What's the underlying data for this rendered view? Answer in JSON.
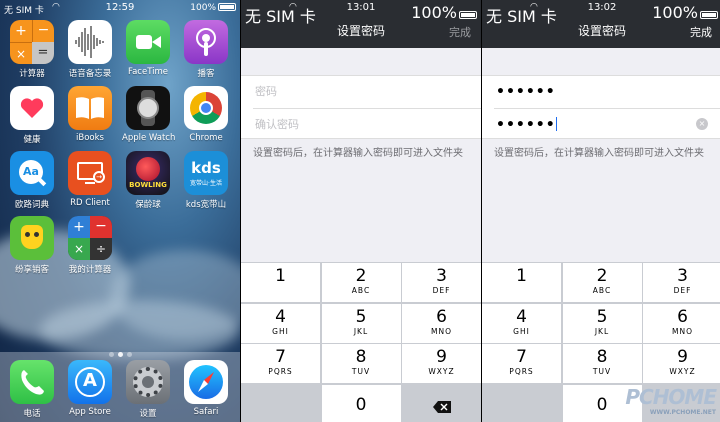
{
  "home": {
    "status": {
      "carrier": "无 SIM 卡",
      "time": "12:59",
      "battery": "100%"
    },
    "apps": [
      {
        "label": "计算器",
        "icon": "calculator-icon"
      },
      {
        "label": "语音备忘录",
        "icon": "voice-memos-icon"
      },
      {
        "label": "FaceTime",
        "icon": "facetime-icon"
      },
      {
        "label": "播客",
        "icon": "podcasts-icon"
      },
      {
        "label": "健康",
        "icon": "health-icon"
      },
      {
        "label": "iBooks",
        "icon": "ibooks-icon"
      },
      {
        "label": "Apple Watch",
        "icon": "apple-watch-icon"
      },
      {
        "label": "Chrome",
        "icon": "chrome-icon"
      },
      {
        "label": "欧路词典",
        "icon": "eudic-icon"
      },
      {
        "label": "RD Client",
        "icon": "rd-client-icon"
      },
      {
        "label": "保龄球",
        "icon": "bowling-icon"
      },
      {
        "label": "kds宽带山",
        "icon": "kds-icon"
      },
      {
        "label": "纷享销客",
        "icon": "fxiaoke-icon"
      },
      {
        "label": "我的计算器",
        "icon": "my-calculator-icon"
      }
    ],
    "dock": [
      {
        "label": "电话",
        "icon": "phone-icon"
      },
      {
        "label": "App Store",
        "icon": "app-store-icon"
      },
      {
        "label": "设置",
        "icon": "settings-icon"
      },
      {
        "label": "Safari",
        "icon": "safari-icon"
      }
    ],
    "kds_badge": "kds",
    "kds_sub": "宽带山·生活",
    "bowling_text": "BOWLING"
  },
  "screen2": {
    "status": {
      "carrier": "无 SIM 卡",
      "time": "13:01",
      "battery": "100%"
    },
    "title": "设置密码",
    "done": "完成",
    "password_placeholder": "密码",
    "confirm_placeholder": "确认密码",
    "hint": "设置密码后，在计算器输入密码即可进入文件夹"
  },
  "screen3": {
    "status": {
      "carrier": "无 SIM 卡",
      "time": "13:02",
      "battery": "100%"
    },
    "title": "设置密码",
    "done": "完成",
    "password_value": "••••••",
    "confirm_value": "••••••",
    "hint": "设置密码后，在计算器输入密码即可进入文件夹"
  },
  "keypad": [
    {
      "n": "1",
      "s": ""
    },
    {
      "n": "2",
      "s": "ABC"
    },
    {
      "n": "3",
      "s": "DEF"
    },
    {
      "n": "4",
      "s": "GHI"
    },
    {
      "n": "5",
      "s": "JKL"
    },
    {
      "n": "6",
      "s": "MNO"
    },
    {
      "n": "7",
      "s": "PQRS"
    },
    {
      "n": "8",
      "s": "TUV"
    },
    {
      "n": "9",
      "s": "WXYZ"
    },
    {
      "n": "",
      "s": ""
    },
    {
      "n": "0",
      "s": ""
    },
    {
      "n": "",
      "s": ""
    }
  ],
  "watermark": {
    "big": "PCHOME",
    "small": "WWW.PCHOME.NET"
  }
}
